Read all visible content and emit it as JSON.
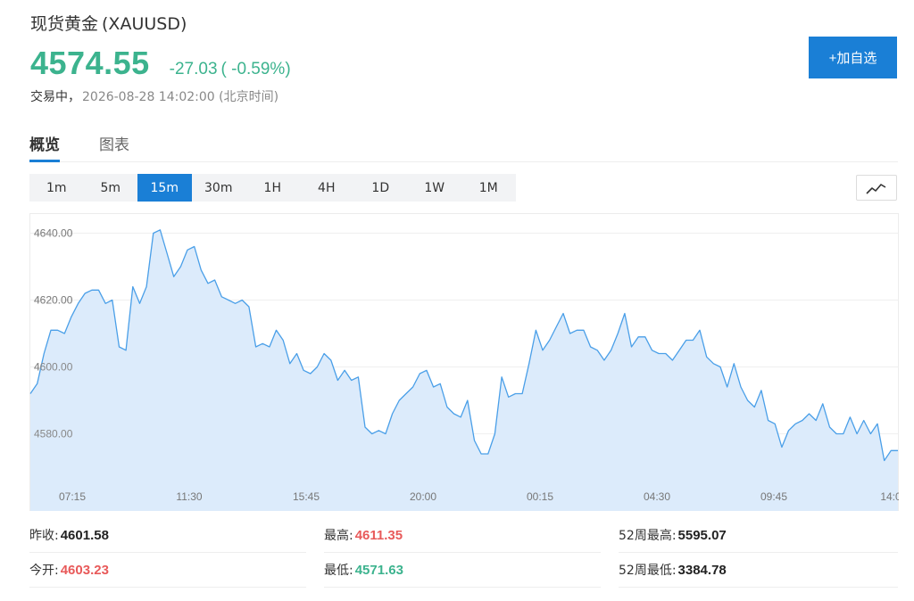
{
  "header": {
    "name": "现货黄金",
    "symbol": "(XAUUSD)",
    "price": "4574.55",
    "change": "-27.03",
    "change_pct": "( -0.59%)",
    "status": "交易中，",
    "timestamp": "2026-08-28 14:02:00 (北京时间)",
    "add_label": "+加自选"
  },
  "tabs": [
    {
      "label": "概览",
      "active": true
    },
    {
      "label": "图表",
      "active": false
    }
  ],
  "intervals": [
    {
      "label": "1m",
      "active": false
    },
    {
      "label": "5m",
      "active": false
    },
    {
      "label": "15m",
      "active": true
    },
    {
      "label": "30m",
      "active": false
    },
    {
      "label": "1H",
      "active": false
    },
    {
      "label": "4H",
      "active": false
    },
    {
      "label": "1D",
      "active": false
    },
    {
      "label": "1W",
      "active": false
    },
    {
      "label": "1M",
      "active": false
    }
  ],
  "chart_type_icon": "line-chart-icon",
  "colors": {
    "accent": "#1a7fd6",
    "down": "#3cb38e",
    "up": "#e85a5a",
    "line": "#4a9fe8",
    "area": "#dcebfb"
  },
  "chart_data": {
    "type": "area",
    "y_ticks": [
      "4640.00",
      "4620.00",
      "4600.00",
      "4580.00"
    ],
    "y_tick_values": [
      4640,
      4620,
      4600,
      4580
    ],
    "ylim": [
      4566,
      4646
    ],
    "x_ticks": [
      "07:15",
      "11:30",
      "15:45",
      "20:00",
      "00:15",
      "04:30",
      "09:45",
      "14:0"
    ],
    "grid": true,
    "values": [
      4592,
      4595,
      4604,
      4611,
      4611,
      4610,
      4615,
      4619,
      4622,
      4623,
      4623,
      4619,
      4620,
      4606,
      4605,
      4624,
      4619,
      4624,
      4640,
      4641,
      4634,
      4627,
      4630,
      4635,
      4636,
      4629,
      4625,
      4626,
      4621,
      4620,
      4619,
      4620,
      4618,
      4606,
      4607,
      4606,
      4611,
      4608,
      4601,
      4604,
      4599,
      4598,
      4600,
      4604,
      4602,
      4596,
      4599,
      4596,
      4597,
      4582,
      4580,
      4581,
      4580,
      4586,
      4590,
      4592,
      4594,
      4598,
      4599,
      4594,
      4595,
      4588,
      4586,
      4585,
      4590,
      4578,
      4574,
      4574,
      4580,
      4597,
      4591,
      4592,
      4592,
      4601,
      4611,
      4605,
      4608,
      4612,
      4616,
      4610,
      4611,
      4611,
      4606,
      4605,
      4602,
      4605,
      4610,
      4616,
      4606,
      4609,
      4609,
      4605,
      4604,
      4604,
      4602,
      4605,
      4608,
      4608,
      4611,
      4603,
      4601,
      4600,
      4594,
      4601,
      4594,
      4590,
      4588,
      4593,
      4584,
      4583,
      4576,
      4581,
      4583,
      4584,
      4586,
      4584,
      4589,
      4582,
      4580,
      4580,
      4585,
      4580,
      4584,
      4580,
      4583,
      4572,
      4575,
      4575
    ]
  },
  "stats": {
    "prev_close_label": "昨收:",
    "prev_close": "4601.58",
    "high_label": "最高:",
    "high": "4611.35",
    "w52_high_label": "52周最高:",
    "w52_high": "5595.07",
    "open_label": "今开:",
    "open": "4603.23",
    "low_label": "最低:",
    "low": "4571.63",
    "w52_low_label": "52周最低:",
    "w52_low": "3384.78"
  }
}
